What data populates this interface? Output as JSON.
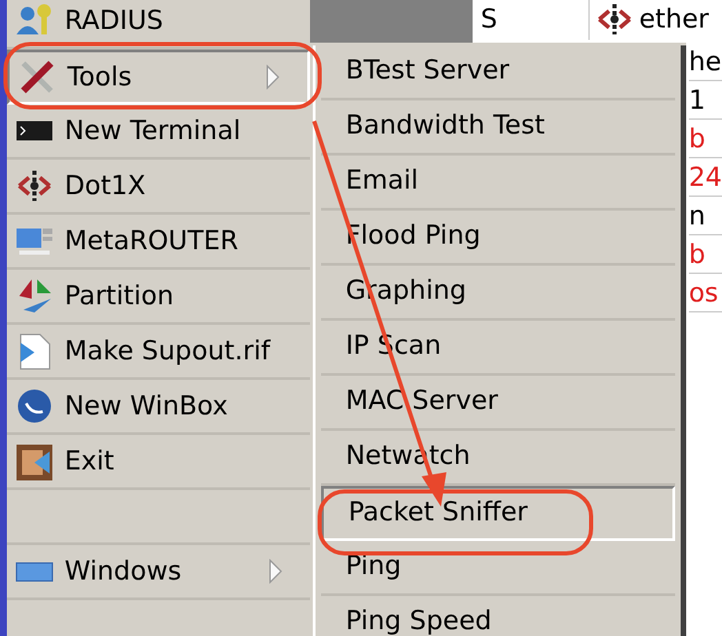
{
  "main_menu": [
    {
      "label": "RADIUS",
      "kind": "radius",
      "selected": false,
      "submenu": false
    },
    {
      "label": "Tools",
      "kind": "tools",
      "selected": true,
      "submenu": true
    },
    {
      "label": "New Terminal",
      "kind": "terminal",
      "selected": false,
      "submenu": false
    },
    {
      "label": "Dot1X",
      "kind": "dot1x",
      "selected": false,
      "submenu": false
    },
    {
      "label": "MetaROUTER",
      "kind": "meta",
      "selected": false,
      "submenu": false
    },
    {
      "label": "Partition",
      "kind": "partition",
      "selected": false,
      "submenu": false
    },
    {
      "label": "Make Supout.rif",
      "kind": "file",
      "selected": false,
      "submenu": false
    },
    {
      "label": "New WinBox",
      "kind": "winbox",
      "selected": false,
      "submenu": false
    },
    {
      "label": "Exit",
      "kind": "exit",
      "selected": false,
      "submenu": false
    },
    {
      "kind": "blank"
    },
    {
      "label": "Windows",
      "kind": "windows",
      "selected": false,
      "submenu": true
    }
  ],
  "tools_submenu": [
    {
      "label": "BTest Server",
      "selected": false
    },
    {
      "label": "Bandwidth Test",
      "selected": false
    },
    {
      "label": "Email",
      "selected": false
    },
    {
      "label": "Flood Ping",
      "selected": false
    },
    {
      "label": "Graphing",
      "selected": false
    },
    {
      "label": "IP Scan",
      "selected": false
    },
    {
      "label": "MAC Server",
      "selected": false
    },
    {
      "label": "Netwatch",
      "selected": false
    },
    {
      "label": "Packet Sniffer",
      "selected": true
    },
    {
      "label": "Ping",
      "selected": false
    },
    {
      "label": "Ping Speed",
      "selected": false
    }
  ],
  "background_table": {
    "row": {
      "column_1": "S",
      "column_2": "ether"
    },
    "fragments": [
      {
        "text": "he",
        "color": "#000000"
      },
      {
        "text": "1",
        "color": "#000000"
      },
      {
        "text": "b",
        "color": "#e02020"
      },
      {
        "text": "24",
        "color": "#e02020"
      },
      {
        "text": "n",
        "color": "#000000"
      },
      {
        "text": "b",
        "color": "#e02020"
      },
      {
        "text": "os",
        "color": "#e02020"
      }
    ]
  }
}
